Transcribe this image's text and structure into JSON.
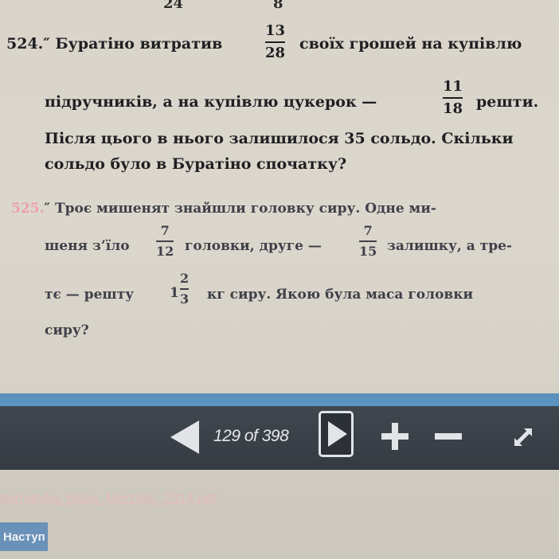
{
  "top_fragment": {
    "left": "24",
    "right": "8"
  },
  "problem_524": {
    "number": "524.″",
    "line1_a": "Буратіно витратив",
    "frac1_num": "13",
    "frac1_den": "28",
    "line1_b": "своїх грошей на купівлю",
    "line2_a": "підручників, а на купівлю цукерок —",
    "frac2_num": "11",
    "frac2_den": "18",
    "line2_b": "решти.",
    "line3": "Після цього в нього залишилося 35 сольдо. Скільки",
    "line4": "сольдо було в Буратіно спочатку?"
  },
  "problem_525": {
    "number": "525.",
    "mark": "″",
    "line1": "Троє мишенят знайшли головку сиру. Одне ми-",
    "line2_a": "шеня з’їло",
    "frac1_num": "7",
    "frac1_den": "12",
    "line2_b": "головки, друге —",
    "frac2_num": "7",
    "frac2_den": "15",
    "line2_c": "залишку, а тре-",
    "line3_a": "тє — решту",
    "mixed_whole": "1",
    "mixed_num": "2",
    "mixed_den": "3",
    "line3_b": "кг сиру. Якою була маса головки",
    "line4": "сиру?"
  },
  "toolbar": {
    "page_counter": "129 of 398",
    "icon_prev": "left-arrow-icon",
    "icon_next": "right-arrow-icon",
    "icon_zoom_in": "plus-icon",
    "icon_zoom_out": "minus-icon",
    "icon_fullscreen": "expand-icon"
  },
  "footer": {
    "filename": "atematyka_6klas_Merzljak_2014.pdf",
    "next_label": "Наступ"
  },
  "colors": {
    "toolbar": "#3a4047",
    "accent_band": "#5c93c2",
    "problem_number_highlight": "#f0a0a8"
  }
}
